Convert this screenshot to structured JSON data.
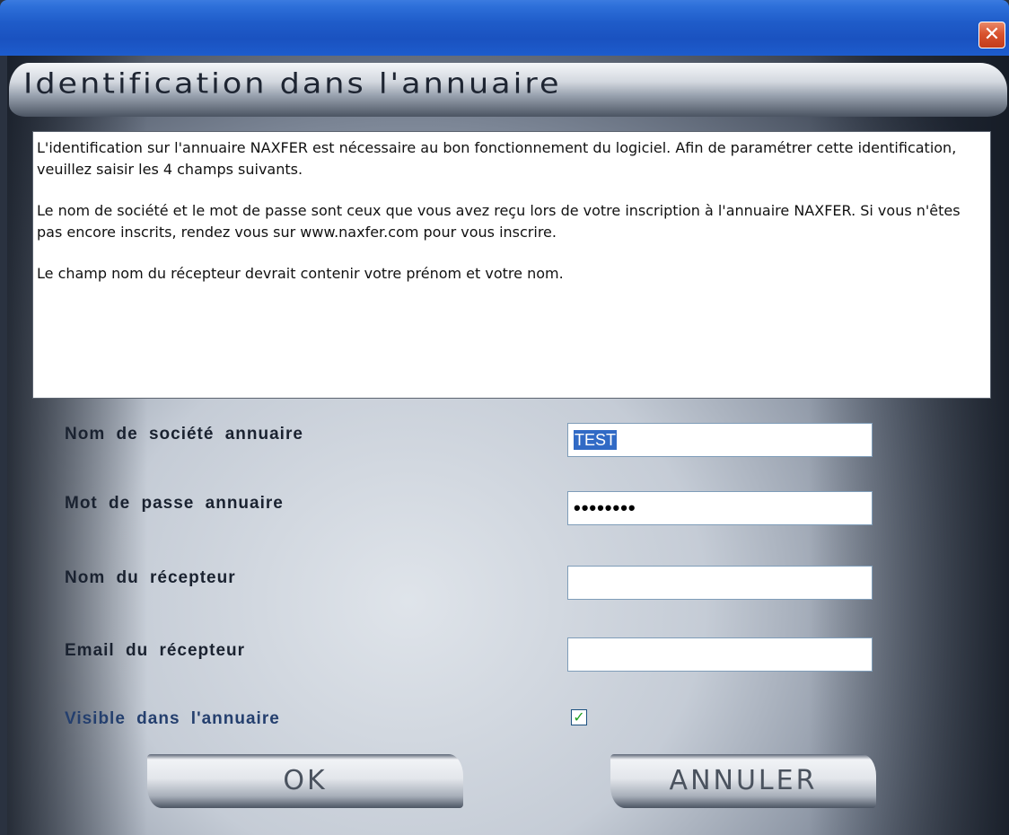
{
  "window": {
    "close_glyph": "✕"
  },
  "header": {
    "title": "Identification dans l'annuaire"
  },
  "info": {
    "paragraphs": [
      "L'identification sur l'annuaire NAXFER est nécessaire au bon fonctionnement du logiciel. Afin de paramétrer cette identification, veuillez saisir les 4 champs suivants.",
      "Le nom de société et le mot de passe sont ceux que vous avez reçu lors de votre inscription à l'annuaire NAXFER. Si vous n'êtes pas encore inscrits, rendez vous sur www.naxfer.com pour vous inscrire.",
      "Le champ nom du récepteur devrait contenir votre prénom et votre nom."
    ]
  },
  "form": {
    "company": {
      "label": "Nom de société annuaire",
      "value": "TEST"
    },
    "password": {
      "label": "Mot de passe annuaire",
      "value": "••••••••"
    },
    "receiver_name": {
      "label": "Nom du récepteur",
      "value": ""
    },
    "receiver_email": {
      "label": "Email du récepteur",
      "value": ""
    },
    "visible": {
      "label": "Visible dans l'annuaire",
      "checked": true,
      "check_glyph": "✓"
    }
  },
  "buttons": {
    "ok": "OK",
    "cancel": "ANNULER"
  },
  "colors": {
    "titlebar": "#1f5cc9",
    "close_button": "#d9532f",
    "selection": "#316ac5",
    "checkmark": "#21a121"
  }
}
